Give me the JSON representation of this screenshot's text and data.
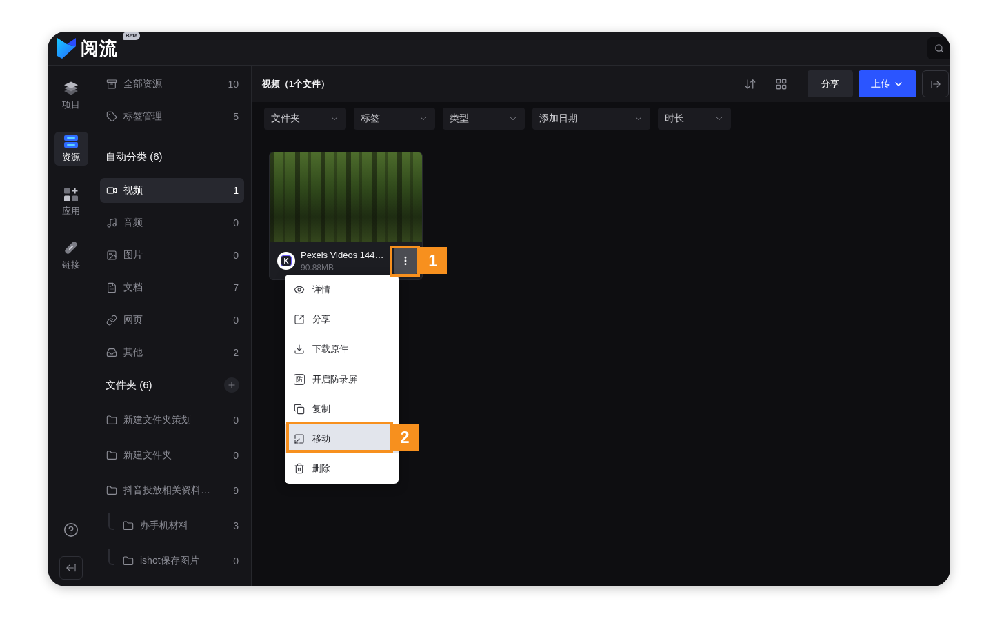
{
  "app": {
    "name": "阅流",
    "badge": "Beta"
  },
  "rail": {
    "items": [
      {
        "label": "项目",
        "kind": "projects",
        "selected": false
      },
      {
        "label": "资源",
        "kind": "resources",
        "selected": true
      },
      {
        "label": "应用",
        "kind": "apps",
        "selected": false
      },
      {
        "label": "链接",
        "kind": "links",
        "selected": false
      }
    ]
  },
  "sidebar": {
    "items": [
      {
        "label": "全部资源",
        "kind": "all",
        "count": "10",
        "selected": false
      },
      {
        "label": "标签管理",
        "kind": "tags",
        "count": "5",
        "selected": false
      }
    ],
    "auto_category": {
      "title": "自动分类 (6)",
      "items": [
        {
          "label": "视频",
          "kind": "video",
          "count": "1",
          "selected": true
        },
        {
          "label": "音频",
          "kind": "audio",
          "count": "0",
          "selected": false
        },
        {
          "label": "图片",
          "kind": "image",
          "count": "0",
          "selected": false
        },
        {
          "label": "文档",
          "kind": "document",
          "count": "7",
          "selected": false
        },
        {
          "label": "网页",
          "kind": "webpage",
          "count": "0",
          "selected": false
        },
        {
          "label": "其他",
          "kind": "other",
          "count": "2",
          "selected": false
        }
      ]
    },
    "folders": {
      "title": "文件夹 (6)",
      "items": [
        {
          "label": "新建文件夹策划",
          "count": "0",
          "selected": false
        },
        {
          "label": "新建文件夹",
          "count": "0",
          "selected": false
        },
        {
          "label": "抖音投放相关资料…",
          "count": "9",
          "selected": false,
          "children": [
            {
              "label": "办手机材料",
              "count": "3",
              "selected": false
            },
            {
              "label": "ishot保存图片",
              "count": "0",
              "selected": false
            }
          ]
        }
      ]
    }
  },
  "header": {
    "title": "视频（1个文件）",
    "share_button": "分享",
    "upload_button": "上传"
  },
  "filters": [
    {
      "label": "文件夹"
    },
    {
      "label": "标签"
    },
    {
      "label": "类型"
    },
    {
      "label": "添加日期"
    },
    {
      "label": "时长"
    }
  ],
  "files": [
    {
      "title": "Pexels Videos 144…",
      "size": "90.88MB",
      "source_badge": "K",
      "callout": "1",
      "menu": {
        "groups": [
          [
            {
              "label": "详情",
              "kind": "details",
              "selected": false
            },
            {
              "label": "分享",
              "kind": "share",
              "selected": false
            },
            {
              "label": "下载原件",
              "kind": "download",
              "selected": false
            }
          ],
          [
            {
              "label": "开启防录屏",
              "kind": "protect",
              "glyph": "防",
              "selected": false
            },
            {
              "label": "复制",
              "kind": "copy",
              "selected": false
            },
            {
              "label": "移动",
              "kind": "move",
              "selected": true,
              "callout": "2"
            },
            {
              "label": "删除",
              "kind": "delete",
              "selected": false
            }
          ]
        ]
      }
    }
  ]
}
